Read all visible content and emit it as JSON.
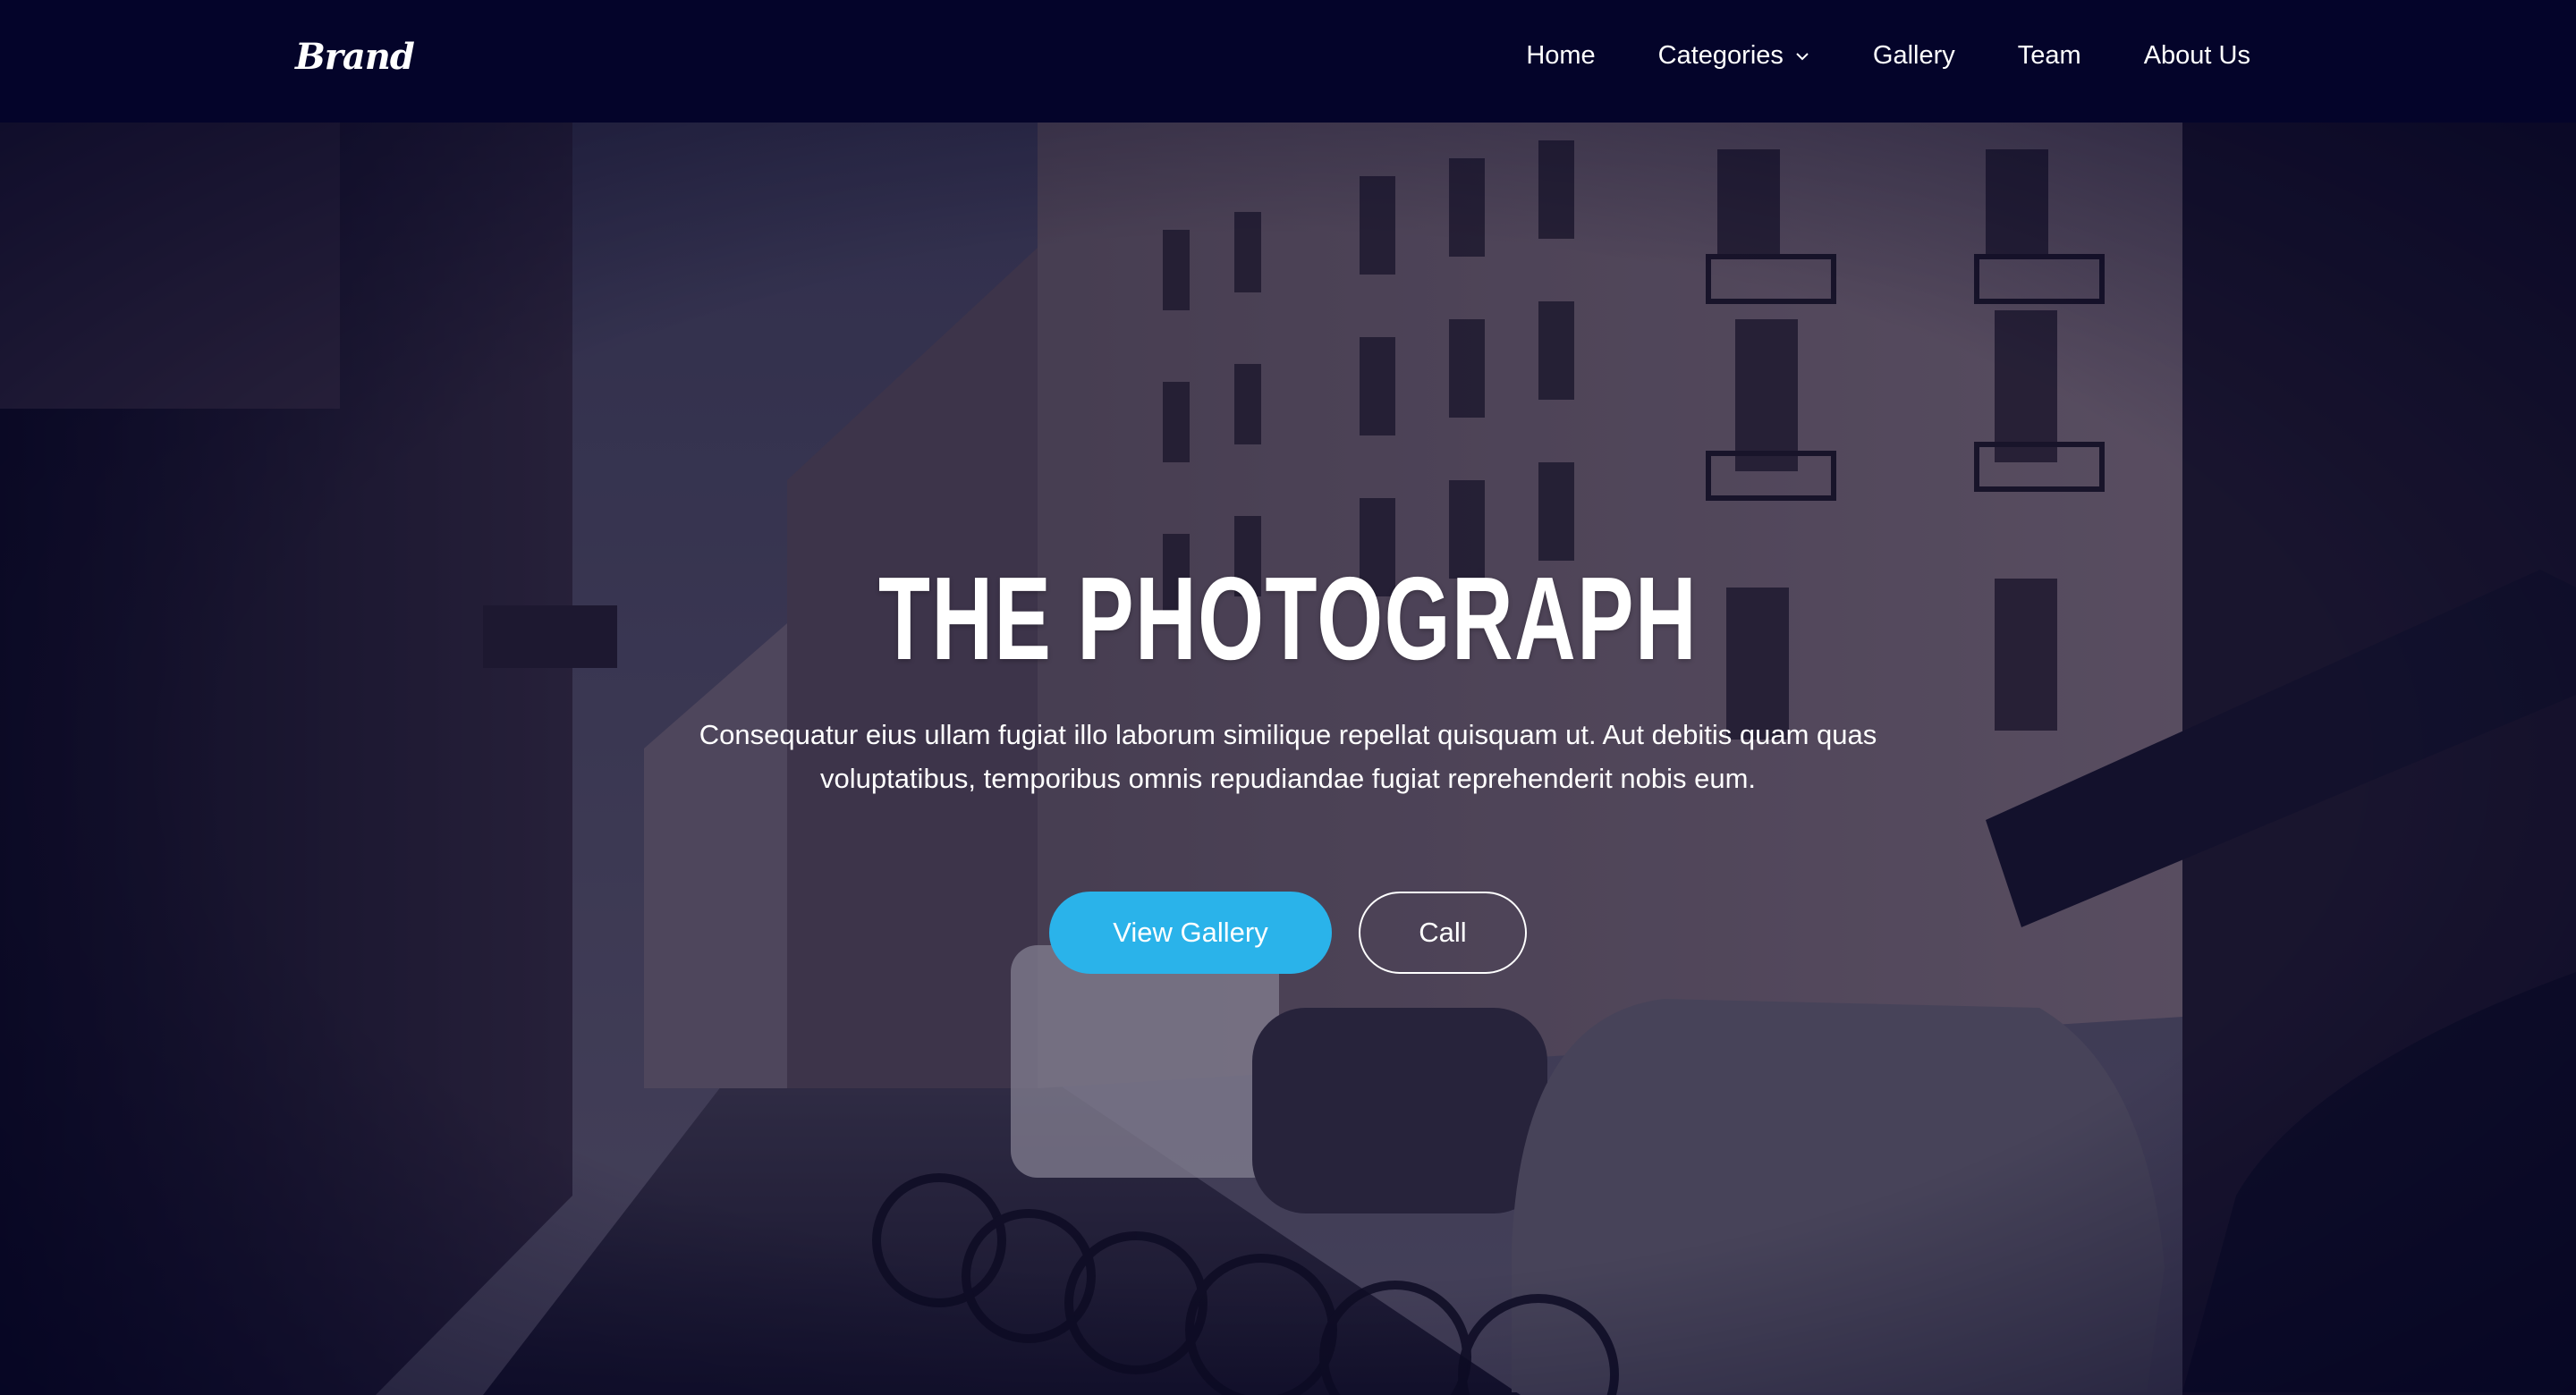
{
  "navbar": {
    "brand": "Brand",
    "items": [
      {
        "label": "Home"
      },
      {
        "label": "Categories",
        "has_dropdown": true
      },
      {
        "label": "Gallery"
      },
      {
        "label": "Team"
      },
      {
        "label": "About Us"
      }
    ]
  },
  "hero": {
    "title": "THE PHOTOGRAPH",
    "text": "Consequatur eius ullam fugiat illo laborum similique repellat quisquam ut. Aut debitis quam quas voluptatibus, temporibus omnis repudiandae fugiat reprehenderit nobis eum.",
    "primary_button": "View Gallery",
    "secondary_button": "Call"
  },
  "colors": {
    "navbar_bg": "#04042a",
    "primary_button": "#2ab3ea",
    "text": "#ffffff"
  },
  "icons": {
    "dropdown": "chevron-down-icon"
  }
}
